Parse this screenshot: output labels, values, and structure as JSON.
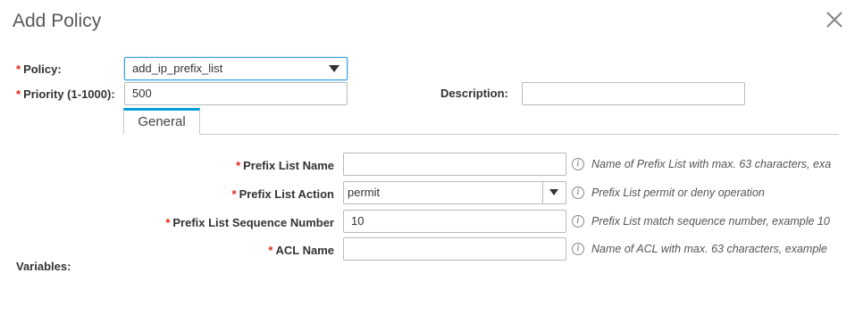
{
  "dialog": {
    "title": "Add Policy",
    "close_icon": "close-icon"
  },
  "form": {
    "policy": {
      "label": "Policy:",
      "value": "add_ip_prefix_list"
    },
    "priority": {
      "label": "Priority (1-1000):",
      "value": "500"
    },
    "description": {
      "label": "Description:",
      "value": ""
    },
    "variables_label": "Variables:"
  },
  "tabs": [
    {
      "label": "General",
      "active": true
    }
  ],
  "general": {
    "prefix_list_name": {
      "label": "Prefix List Name",
      "value": "",
      "hint": "Name of Prefix List with max. 63 characters, exa"
    },
    "prefix_list_action": {
      "label": "Prefix List Action",
      "value": "permit",
      "hint": "Prefix List permit or deny operation"
    },
    "prefix_list_sequence": {
      "label": "Prefix List Sequence Number",
      "value": "10",
      "hint": "Prefix List match sequence number, example 10"
    },
    "acl_name": {
      "label": "ACL Name",
      "value": "",
      "hint": "Name of ACL with max. 63 characters, example"
    }
  },
  "colors": {
    "required": "#e2231a",
    "tab_accent": "#049fd9",
    "focus": "#3ba0e0"
  },
  "required_marker": "*",
  "info_glyph": "i"
}
